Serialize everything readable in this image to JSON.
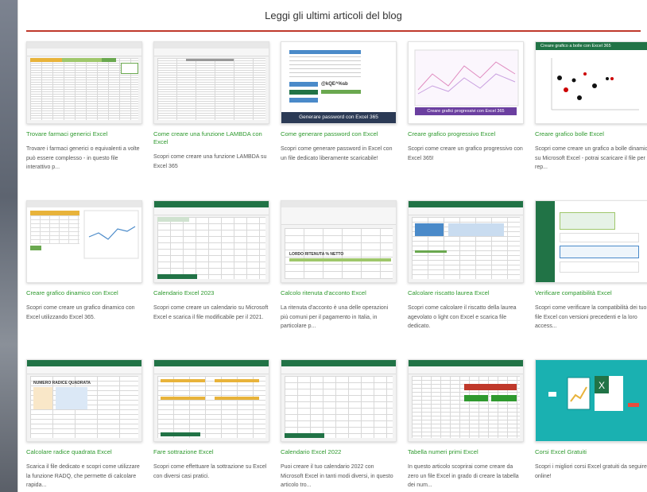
{
  "section_title": "Leggi gli ultimi articoli del blog",
  "colors": {
    "accent_line": "#c0392b",
    "title_link": "#2f9a2f",
    "excel_green": "#217346"
  },
  "articles": [
    {
      "title": "Trovare farmaci generici Excel",
      "desc": "Trovare i farmaci generici o equivalenti a volte può essere complesso - in questo file interattivo p..."
    },
    {
      "title": "Come creare una funzione LAMBDA con Excel",
      "desc": "Scopri come creare una funzione LAMBDA su Excel 365"
    },
    {
      "title": "Come generare password con Excel",
      "desc": "Scopri come generare password in Excel con un file dedicato liberamente scaricabile!"
    },
    {
      "title": "Creare grafico progressivo Excel",
      "desc": "Scopri come creare un grafico progressivo con Excel 365!"
    },
    {
      "title": "Creare grafico bolle Excel",
      "desc": "Scopri come creare un grafico a bolle dinamico su Microsoft Excel - potrai scaricare il file per rep..."
    },
    {
      "title": "Creare grafico dinamico con Excel",
      "desc": "Scopri come creare un grafico dinamico con Excel utilizzando Excel 365."
    },
    {
      "title": "Calendario Excel 2023",
      "desc": "Scopri come creare un calendario su Microsoft Excel e scarica il file modificabile per il 2021."
    },
    {
      "title": "Calcolo ritenuta d'acconto Excel",
      "desc": "La ritenuta d'acconto è una delle operazioni più comuni per il pagamento in Italia, in particolare p..."
    },
    {
      "title": "Calcolare riscatto laurea Excel",
      "desc": "Scopri come calcolare il riscatto della laurea agevolato o light con Excel e scarica file dedicato."
    },
    {
      "title": "Verificare compatibilità Excel",
      "desc": "Scopri come verificare la compatibilità dei tuoi file Excel con versioni precedenti e la loro access..."
    },
    {
      "title": "Calcolare radice quadrata Excel",
      "desc": "Scarica il file dedicato e scopri come utilizzare la funzione RADQ, che permette di calcolare rapida..."
    },
    {
      "title": "Fare sottrazione Excel",
      "desc": "Scopri come effettuare la sottrazione su Excel con diversi casi pratici."
    },
    {
      "title": "Calendario Excel 2022",
      "desc": "Puoi creare il tuo calendario 2022 con Microsoft Excel in tanti modi diversi, in questo articolo tro..."
    },
    {
      "title": "Tabella numeri primi Excel",
      "desc": "In questo articolo scoprirai come creare da zero un file Excel in grado di creare la tabella dei num..."
    },
    {
      "title": "Corsi Excel Gratuiti",
      "desc": "Scopri i migliori corsi Excel gratuiti da seguire online!"
    }
  ],
  "thumb_texts": {
    "password_banner": "Generare password con Excel 365",
    "progressivo_banner": "Creare grafici progressivi con Excel 365",
    "bolle_header": "Creare grafico a bolle con Excel 365",
    "ritenuta_cols": "LORDO   RITENUTA %   NETTO",
    "radice_cols": "NUMERO   RADICE QUADRATA"
  }
}
